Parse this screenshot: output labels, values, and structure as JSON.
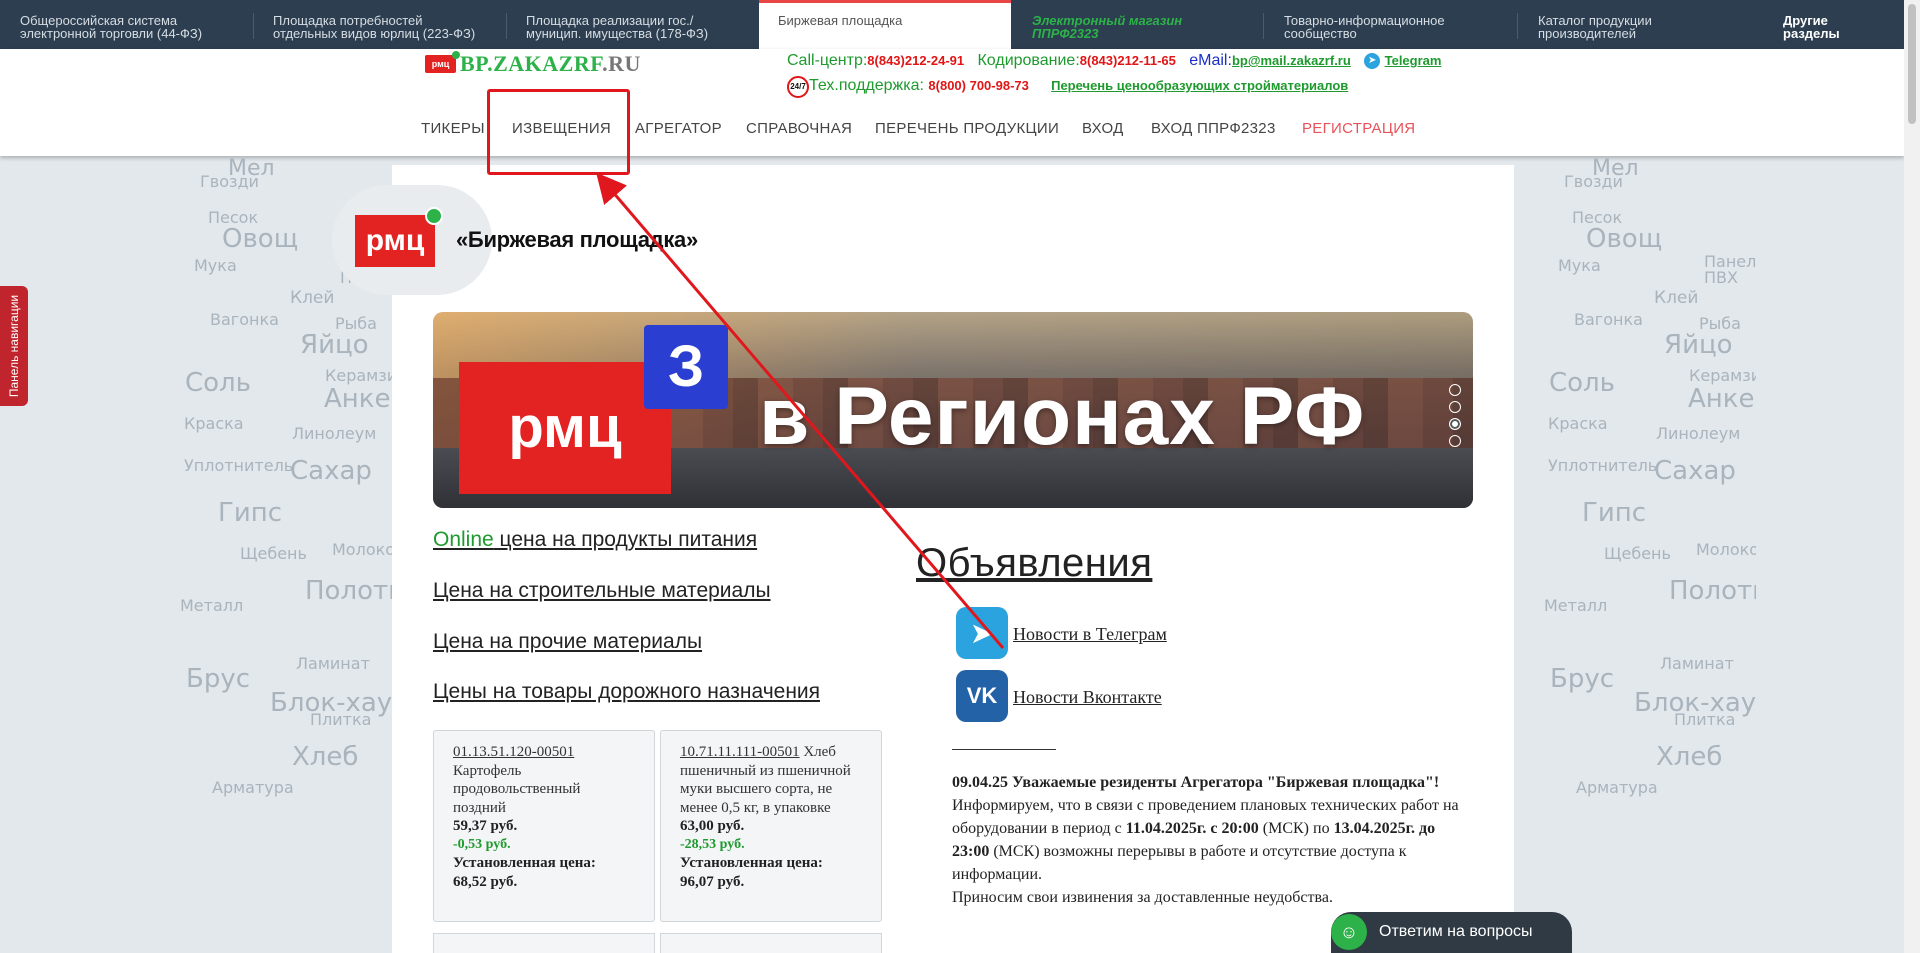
{
  "topbar": {
    "items": [
      {
        "line1": "Общероссийская система",
        "line2": "электронной торговли (44-ФЗ)"
      },
      {
        "line1": "Площадка потребностей",
        "line2": "отдельных видов юрлиц (223-ФЗ)"
      },
      {
        "line1": "Площадка реализации гос./",
        "line2": "муницип. имущества (178-ФЗ)"
      },
      {
        "line1": "Биржевая площадка",
        "line2": ""
      },
      {
        "line1": "Электронный магазин",
        "line2": "ППРФ2323"
      },
      {
        "line1": "Товарно-информационное",
        "line2": "сообщество"
      },
      {
        "line1": "Каталог продукции",
        "line2": "производителей"
      },
      {
        "line1": "Другие",
        "line2": "разделы"
      }
    ]
  },
  "header": {
    "logo_small": "рмц",
    "site_name_a": "BP.ZAKAZRF",
    "site_name_b": ".RU",
    "call_label": "Call-центр:",
    "call_phone": "8(843)212-24-91",
    "coding_label": "Кодирование:",
    "coding_phone": "8(843)212-11-65",
    "email_label": "eMail:",
    "email_value": "bp@mail.zakazrf.ru",
    "telegram": "Telegram",
    "badge": "24/7",
    "support_label": "Тех.поддержка:",
    "support_phone": "8(800) 700-98-73",
    "price_list_link": "Перечень ценообразующих стройматериалов"
  },
  "nav": {
    "items": [
      "ТИКЕРЫ",
      "ИЗВЕЩЕНИЯ",
      "АГРЕГАТОР",
      "СПРАВОЧНАЯ",
      "ПЕРЕЧЕНЬ ПРОДУКЦИИ",
      "ВХОД",
      "ВХОД ППРФ2323",
      "РЕГИСТРАЦИЯ"
    ]
  },
  "cloud_words": [
    "Мел",
    "Гвозди",
    "Песок",
    "Овощ",
    "Мука",
    "Панели",
    "ПВХ",
    "Клей",
    "Вагонка",
    "Рыба",
    "Яйцо",
    "Соль",
    "Керамзит",
    "Анкер",
    "Краска",
    "Линолеум",
    "Уплотнитель",
    "Сахар",
    "Гипс",
    "Щебень",
    "Молоко",
    "Полотно",
    "Металл",
    "Ламинат",
    "Брус",
    "Блок-хаус",
    "Плитка",
    "Хлеб",
    "Арматура"
  ],
  "brand": {
    "logo": "рмц",
    "title": "«Биржевая площадка»"
  },
  "banner": {
    "rmc": "рмц",
    "three": "З",
    "slogan": "в Регионах РФ"
  },
  "price_links": {
    "online_word": "Online",
    "food": " цена на продукты питания",
    "construction": "Цена на строительные материалы",
    "other": "Цена на прочие материалы",
    "road": "Цены на товары дорожного назначения"
  },
  "cards": [
    {
      "code": "01.13.51.120-00501",
      "name": "Картофель продовольственный поздний",
      "price": "59,37 руб.",
      "delta": "-0,53 руб.",
      "set_label": "Установленная цена:",
      "set_price": "68,52 руб."
    },
    {
      "code": "10.71.11.111-00501",
      "name": "Хлеб пшеничный из пшеничной муки высшего сорта, не менее 0,5 кг, в упаковке",
      "price": "63,00 руб.",
      "delta": "-28,53 руб.",
      "set_label": "Установленная цена:",
      "set_price": "96,07 руб."
    }
  ],
  "announcements": {
    "title": "Объявления",
    "telegram_news": "Новости в Телеграм",
    "vk_news": "Новости Вконтакте",
    "news_heading": "09.04.25 Уважаемые резиденты Агрегатора \"Биржевая площадка\"!",
    "news_p1_a": "Информируем, что в связи с проведением плановых технических работ на оборудовании в период с ",
    "news_p1_b": "11.04.2025г. с 20:00",
    "news_p1_c": " (МСК) по ",
    "news_p1_d": "13.04.2025г. до 23:00",
    "news_p1_e": " (МСК) возможны перерывы в работе и отсутствие доступа к информации.",
    "news_p2": "Приносим свои извинения за доставленные неудобства."
  },
  "side_tab": "Панель навигации",
  "chat": "Ответим на вопросы",
  "colors": {
    "topbar": "#2c3e4f",
    "accent_red": "#e32222",
    "accent_green": "#2db24a",
    "annotation": "#e0171c"
  }
}
